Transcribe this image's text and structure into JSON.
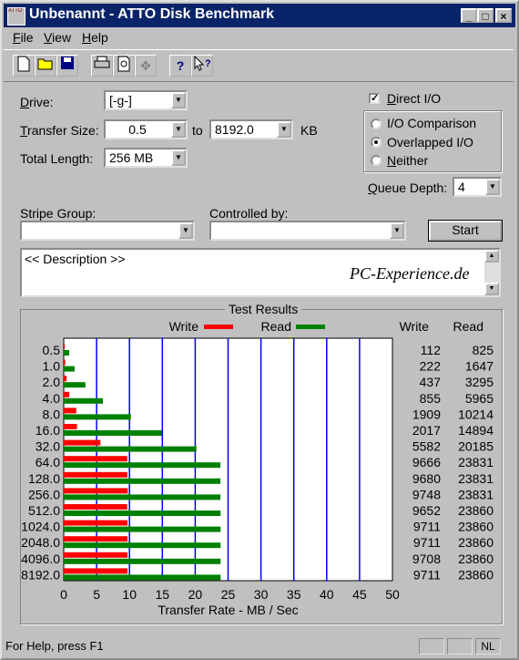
{
  "window": {
    "title": "Unbenannt - ATTO Disk Benchmark",
    "app_icon_text": "ATTO"
  },
  "menu": [
    "File",
    "View",
    "Help"
  ],
  "toolbar_icons": [
    "new-icon",
    "open-icon",
    "save-icon",
    "print-icon",
    "print-preview-icon",
    "move-icon",
    "help-icon",
    "context-help-icon"
  ],
  "form": {
    "drive_label": "Drive:",
    "drive_value": "[-g-]",
    "transfer_size_label": "Transfer Size:",
    "transfer_from": "0.5",
    "to_label": "to",
    "transfer_to": "8192.0",
    "kb_label": "KB",
    "total_length_label": "Total Length:",
    "total_length_value": "256 MB",
    "direct_io_label": "Direct I/O",
    "direct_io_checked": true,
    "io_options": [
      "I/O Comparison",
      "Overlapped I/O",
      "Neither"
    ],
    "io_selected": "Overlapped I/O",
    "queue_depth_label": "Queue Depth:",
    "queue_depth_value": "4",
    "stripe_group_label": "Stripe Group:",
    "controlled_by_label": "Controlled by:",
    "start_label": "Start",
    "description": "<< Description >>",
    "watermark": "PC-Experience.de"
  },
  "results": {
    "group_title": "Test Results",
    "legend_write": "Write",
    "legend_read": "Read",
    "col_write": "Write",
    "col_read": "Read",
    "write_color": "#ff0000",
    "read_color": "#008000",
    "grid_color": "#0000ff"
  },
  "chart_data": {
    "type": "bar",
    "orientation": "horizontal",
    "categories": [
      "0.5",
      "1.0",
      "2.0",
      "4.0",
      "8.0",
      "16.0",
      "32.0",
      "64.0",
      "128.0",
      "256.0",
      "512.0",
      "1024.0",
      "2048.0",
      "4096.0",
      "8192.0"
    ],
    "series": [
      {
        "name": "Write",
        "values": [
          112,
          222,
          437,
          855,
          1909,
          2017,
          5582,
          9666,
          9680,
          9748,
          9652,
          9711,
          9711,
          9708,
          9711
        ]
      },
      {
        "name": "Read",
        "values": [
          825,
          1647,
          3295,
          5965,
          10214,
          14894,
          20185,
          23831,
          23831,
          23831,
          23860,
          23860,
          23860,
          23860,
          23860
        ]
      }
    ],
    "xlabel": "Transfer Rate - MB / Sec",
    "ylabel": "",
    "xlim": [
      0,
      50
    ],
    "x_ticks": [
      "0",
      "5",
      "10",
      "15",
      "20",
      "25",
      "30",
      "35",
      "40",
      "45",
      "50"
    ],
    "value_unit_divisor": 1000,
    "grid": true
  },
  "status": {
    "text": "For Help, press F1",
    "indicator": "NL"
  }
}
